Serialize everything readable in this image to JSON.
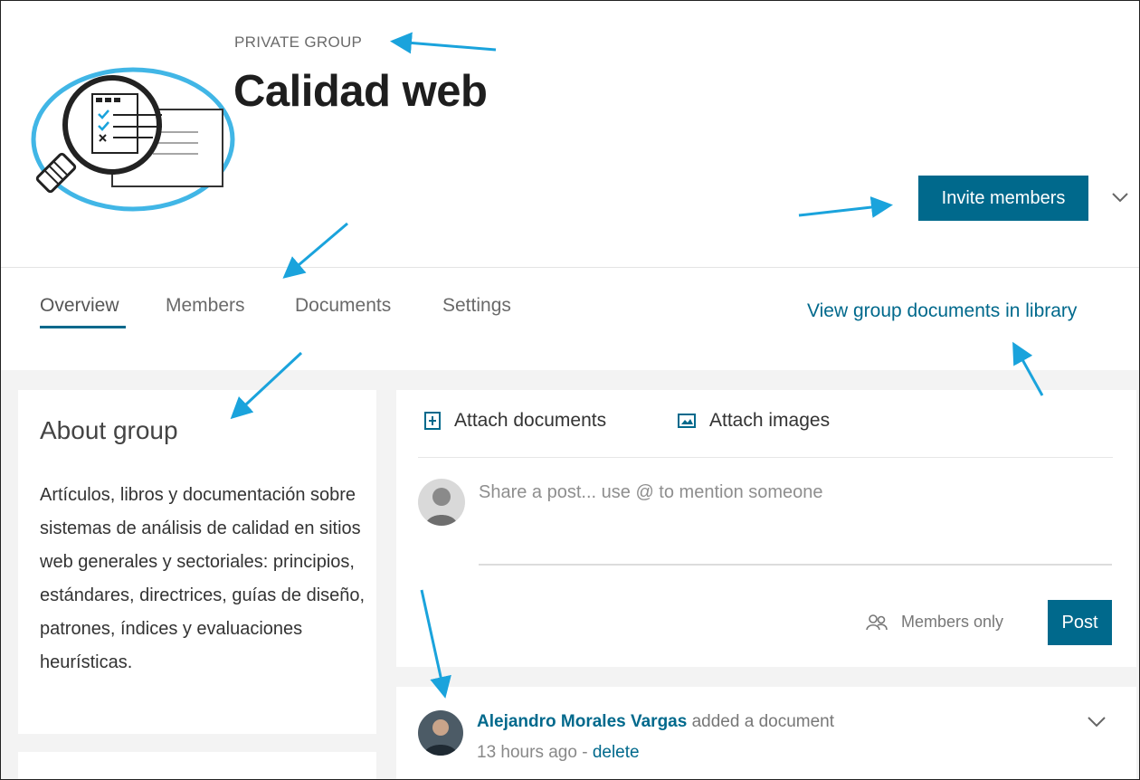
{
  "header": {
    "privacy_label": "PRIVATE GROUP",
    "title": "Calidad web",
    "invite_button": "Invite members"
  },
  "tabs": [
    {
      "label": "Overview",
      "active": true
    },
    {
      "label": "Members",
      "active": false
    },
    {
      "label": "Documents",
      "active": false
    },
    {
      "label": "Settings",
      "active": false
    }
  ],
  "library_link": "View group documents in library",
  "about": {
    "title": "About group",
    "description": "Artículos, libros y documentación sobre sistemas de análisis de calidad en sitios web generales y sectoriales: principios, estándares, directrices, guías de diseño, patrones, índices y evaluaciones heurísticas."
  },
  "composer": {
    "attach_documents": "Attach documents",
    "attach_images": "Attach images",
    "placeholder": "Share a post... use @ to mention someone",
    "audience": "Members only",
    "post_button": "Post"
  },
  "activity": {
    "author": "Alejandro Morales Vargas",
    "action": "added a document",
    "time": "13 hours ago",
    "separator": " - ",
    "delete_label": "delete"
  },
  "colors": {
    "accent": "#00698c",
    "annotation_arrow": "#1aa3dc",
    "logo_ring": "#41b6e6"
  }
}
